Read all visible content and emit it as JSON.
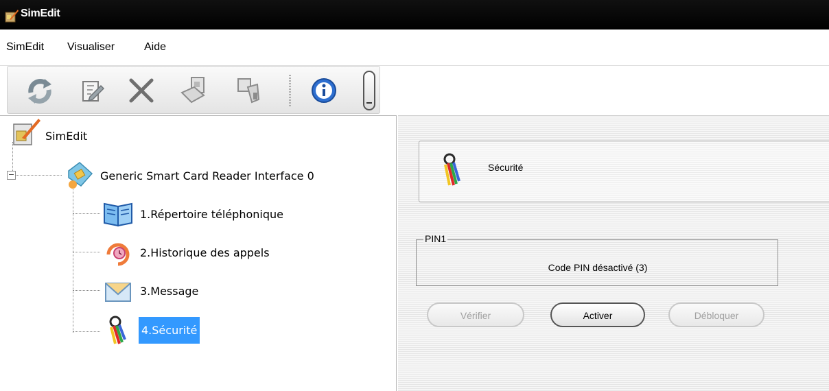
{
  "window": {
    "title": "SimEdit"
  },
  "menu": {
    "items": [
      "SimEdit",
      "Visualiser",
      "Aide"
    ]
  },
  "toolbar": {
    "buttons": [
      "refresh-icon",
      "edit-icon",
      "delete-icon",
      "read-card-icon",
      "write-card-icon",
      "info-icon"
    ]
  },
  "tree": {
    "root_label": "SimEdit",
    "reader_label": "Generic Smart Card Reader Interface 0",
    "items": [
      {
        "label": "1.Répertoire téléphonique",
        "icon": "phonebook-icon"
      },
      {
        "label": "2.Historique des appels",
        "icon": "call-history-icon"
      },
      {
        "label": "3.Message",
        "icon": "message-icon"
      },
      {
        "label": "4.Sécurité",
        "icon": "security-icon",
        "selected": true
      }
    ]
  },
  "detail": {
    "header_title": "Sécurité",
    "pin_group_label": "PIN1",
    "pin_status": "Code PIN désactivé (3)",
    "buttons": {
      "verify": "Vérifier",
      "activate": "Activer",
      "unblock": "Débloquer"
    }
  },
  "colors": {
    "titlebar": "#000000",
    "selection": "#3399ff",
    "pane_background": "#f2f2f2"
  }
}
